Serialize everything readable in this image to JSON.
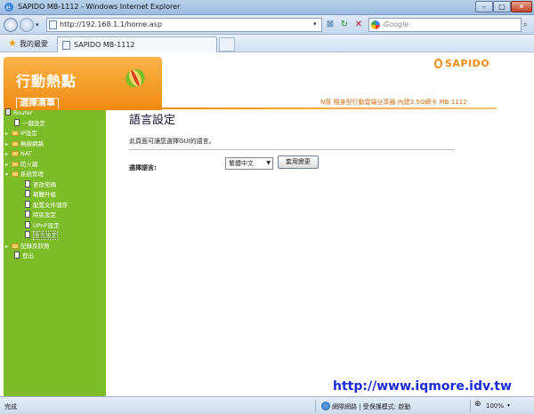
{
  "window": {
    "title": "SAPIDO MB-1112 - Windows Internet Explorer",
    "min": "–",
    "max": "□",
    "close": "✕"
  },
  "address": {
    "url": "http://192.168.1.1/home.asp"
  },
  "search": {
    "placeholder": "Google"
  },
  "favorites": {
    "label": "我的最愛"
  },
  "tab": {
    "label": "SAPIDO MB-1112"
  },
  "page": {
    "menu_header_title": "行動熱點",
    "menu_list_label": "選擇清單",
    "brand": "SAPIDO",
    "product_title": "N匯 隨身型行動雲端分享器 內建3.5G網卡 MB-1112",
    "content_title": "語言設定",
    "content_desc": "此頁面可讓您選擇GUI的語言。",
    "language_label": "選擇語言:",
    "language_value": "繁體中文",
    "apply_label": "套用變更",
    "watermark": "http://www.iqmore.idv.tw"
  },
  "sidebar": {
    "items": [
      {
        "label": "Router",
        "kind": "root",
        "selected": false
      },
      {
        "label": "一鍵設定",
        "kind": "page",
        "selected": false
      },
      {
        "label": "IP設定",
        "kind": "folder",
        "selected": false
      },
      {
        "label": "無線網路",
        "kind": "folder",
        "selected": false
      },
      {
        "label": "NAT",
        "kind": "folder",
        "selected": false
      },
      {
        "label": "防火牆",
        "kind": "folder",
        "selected": false
      },
      {
        "label": "系統管理",
        "kind": "folder-open",
        "selected": false
      },
      {
        "label": "更改密碼",
        "kind": "page",
        "selected": false
      },
      {
        "label": "韌體升級",
        "kind": "page",
        "selected": false
      },
      {
        "label": "配置文件儲存",
        "kind": "page",
        "selected": false
      },
      {
        "label": "時區設定",
        "kind": "page",
        "selected": false
      },
      {
        "label": "UPnP設定",
        "kind": "page",
        "selected": false
      },
      {
        "label": "語言設定",
        "kind": "page",
        "selected": true
      },
      {
        "label": "記錄及狀態",
        "kind": "folder",
        "selected": false
      },
      {
        "label": "登出",
        "kind": "page",
        "selected": false
      }
    ]
  },
  "status": {
    "text": "完成",
    "zone": "網際網路 | 受保護模式: 啟動",
    "zoom": "100%"
  },
  "colors": {
    "accent_orange": "#f08c12",
    "sidebar_green": "#7cbc28",
    "watermark_blue": "#1a2ad8"
  }
}
